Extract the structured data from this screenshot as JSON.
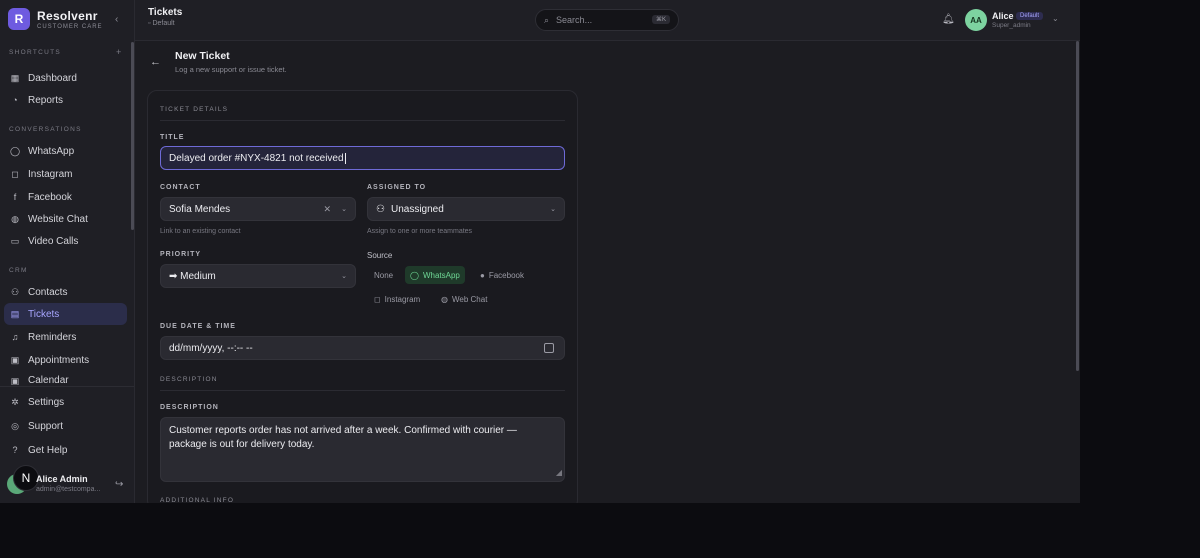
{
  "brand": {
    "logo_letter": "R",
    "name": "Resolvenr",
    "tagline": "CUSTOMER CARE"
  },
  "sidebar": {
    "shortcuts_label": "SHORTCUTS",
    "shortcuts": [
      {
        "label": "Dashboard",
        "icon": "grid-icon"
      },
      {
        "label": "Reports",
        "icon": "chart-icon"
      }
    ],
    "conversations_label": "CONVERSATIONS",
    "conversations": [
      {
        "label": "WhatsApp",
        "icon": "whatsapp-icon"
      },
      {
        "label": "Instagram",
        "icon": "instagram-icon"
      },
      {
        "label": "Facebook",
        "icon": "facebook-icon"
      },
      {
        "label": "Website Chat",
        "icon": "globe-icon"
      },
      {
        "label": "Video Calls",
        "icon": "video-icon"
      }
    ],
    "crm_label": "CRM",
    "crm": [
      {
        "label": "Contacts",
        "icon": "users-icon"
      },
      {
        "label": "Tickets",
        "icon": "ticket-icon",
        "active": true
      },
      {
        "label": "Reminders",
        "icon": "bell-icon"
      },
      {
        "label": "Appointments",
        "icon": "calendar-icon"
      },
      {
        "label": "Calendar",
        "icon": "calendar-icon"
      }
    ],
    "bottom": [
      {
        "label": "Settings",
        "icon": "gear-icon"
      },
      {
        "label": "Support",
        "icon": "lifebuoy-icon"
      },
      {
        "label": "Get Help",
        "icon": "help-icon"
      }
    ],
    "user": {
      "name": "Alice Admin",
      "email": "admin@testcompa...",
      "badge_letter": "N"
    }
  },
  "topbar": {
    "title": "Tickets",
    "subtitle": "Default",
    "search_placeholder": "Search...",
    "search_shortcut": "⌘K",
    "user_initials": "AA",
    "user_name": "Alice",
    "user_badge": "Default",
    "user_role": "Super_admin"
  },
  "page": {
    "title": "New Ticket",
    "subtitle": "Log a new support or issue ticket."
  },
  "form": {
    "section_details": "TICKET DETAILS",
    "title_label": "TITLE",
    "title_value": "Delayed order #NYX-4821 not received",
    "contact_label": "CONTACT",
    "contact_value": "Sofia Mendes",
    "contact_hint": "Link to an existing contact",
    "assigned_label": "ASSIGNED TO",
    "assigned_value": "Unassigned",
    "assigned_hint": "Assign to one or more teammates",
    "priority_label": "PRIORITY",
    "priority_value": "➡ Medium",
    "source_label": "Source",
    "source_options": [
      {
        "label": "None",
        "icon": ""
      },
      {
        "label": "WhatsApp",
        "icon": "whatsapp-icon",
        "selected": true
      },
      {
        "label": "Facebook",
        "icon": "facebook-icon"
      },
      {
        "label": "Instagram",
        "icon": "instagram-icon"
      },
      {
        "label": "Web Chat",
        "icon": "globe-icon"
      }
    ],
    "due_label": "DUE DATE & TIME",
    "due_placeholder": "dd/mm/yyyy, --:-- --",
    "section_description": "DESCRIPTION",
    "description_label": "DESCRIPTION",
    "description_value": "Customer reports order has not arrived after a week. Confirmed with courier — package is out for delivery today.",
    "section_additional": "ADDITIONAL INFO"
  },
  "colors": {
    "accent": "#6e5be0",
    "active_nav_bg": "#2b2d4a",
    "whatsapp_green": "#6fd895"
  }
}
